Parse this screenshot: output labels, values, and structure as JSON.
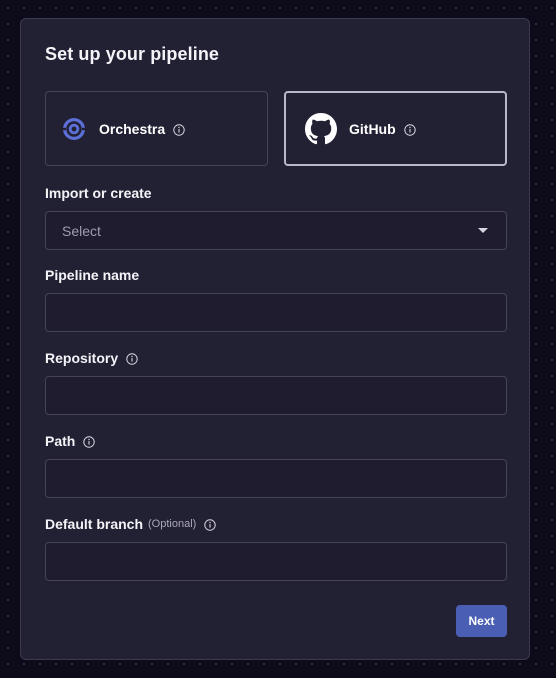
{
  "dialog": {
    "title": "Set up your pipeline"
  },
  "sources": [
    {
      "label": "Orchestra",
      "icon": "orchestra-logo-icon",
      "selected": false
    },
    {
      "label": "GitHub",
      "icon": "github-logo-icon",
      "selected": true
    }
  ],
  "form": {
    "import_label": "Import or create",
    "import_value": "Select",
    "pipeline_name_label": "Pipeline name",
    "pipeline_name_value": "",
    "repository_label": "Repository",
    "repository_value": "",
    "path_label": "Path",
    "path_value": "",
    "default_branch_label": "Default branch",
    "default_branch_optional": "(Optional)",
    "default_branch_value": ""
  },
  "actions": {
    "next_label": "Next"
  },
  "colors": {
    "panel_bg": "#222033",
    "accent_button": "#4a5fb4",
    "orchestra_brand": "#5b6fd6",
    "selected_border": "#b9b8c6"
  }
}
